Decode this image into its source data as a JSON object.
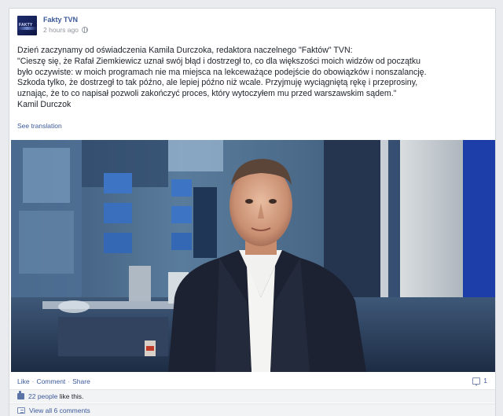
{
  "post": {
    "page_name": "Fakty TVN",
    "timestamp": "2 hours ago",
    "avatar_text": "FAKTY",
    "privacy_icon": "globe-icon",
    "text_lines": [
      "Dzień zaczynamy od oświadczenia Kamila Durczoka, redaktora naczelnego \"Faktów\" TVN:",
      "\"Cieszę się, że Rafał Ziemkiewicz uznał swój błąd i dostrzegł to, co dla większości moich widzów od początku",
      "było oczywiste: w moich programach nie ma miejsca na lekceważące podejście do obowiązków i nonszalancję.",
      "Szkoda tylko, że dostrzegł to tak późno, ale lepiej późno niż wcale. Przyjmuję wyciągniętą rękę i przeprosiny,",
      "uznając, że to co napisał pozwoli zakończyć proces, który wytoczyłem mu przed warszawskim sądem.\"",
      "Kamil Durczok"
    ],
    "see_translation": "See translation"
  },
  "actions": {
    "like": "Like",
    "comment": "Comment",
    "share": "Share",
    "separator": "·",
    "comment_count": "1",
    "comment_icon": "comment-icon"
  },
  "feedback": {
    "likes_count": "22 people",
    "likes_suffix": "like this.",
    "view_comments": "View all 6 comments"
  },
  "colors": {
    "link": "#3b5998",
    "background": "#e9ebee",
    "feedback_bg": "#f2f3f5"
  }
}
